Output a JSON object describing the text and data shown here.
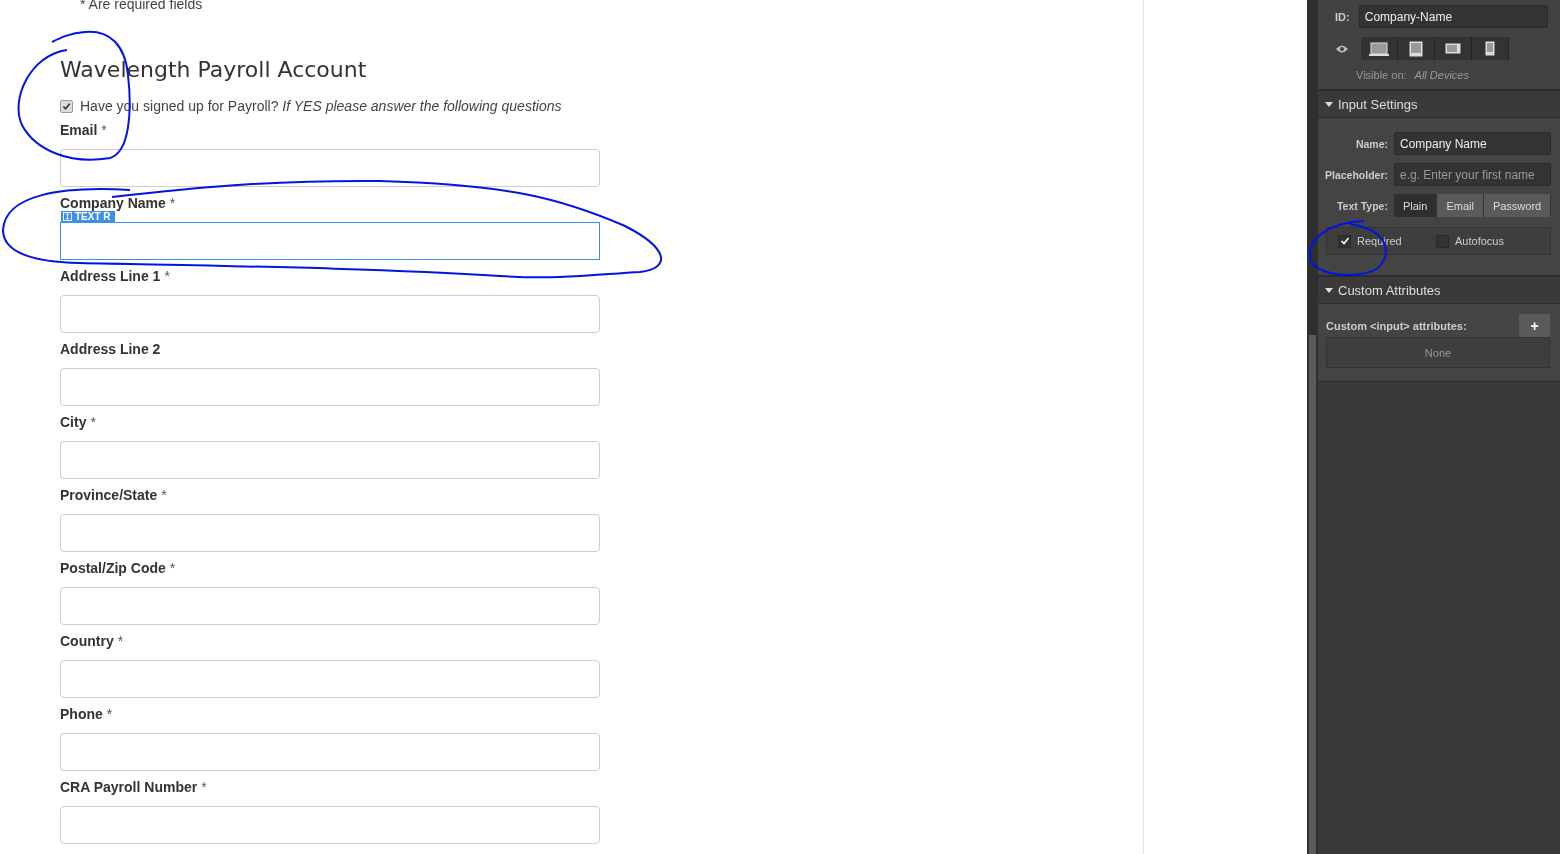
{
  "form": {
    "required_note": "* Are required fields",
    "title": "Wavelength Payroll Account",
    "signup": {
      "checked": true,
      "question": "Have you signed up for Payroll?",
      "hint": "If YES please answer the following questions"
    },
    "fields": [
      {
        "label": "Email",
        "mark": "*",
        "selected": false
      },
      {
        "label": "Company Name",
        "mark": "*",
        "selected": true,
        "tag": "TEXT R"
      },
      {
        "label": "Address Line 1",
        "mark": "*",
        "selected": false
      },
      {
        "label": "Address Line 2",
        "selected": false
      },
      {
        "label": "City",
        "mark": "*",
        "selected": false
      },
      {
        "label": "Province/State",
        "mark": "*",
        "selected": false
      },
      {
        "label": "Postal/Zip Code",
        "mark": "*",
        "selected": false
      },
      {
        "label": "Country",
        "mark": "*",
        "selected": false
      },
      {
        "label": "Phone",
        "mark": "*",
        "selected": false
      },
      {
        "label": "CRA Payroll Number",
        "mark": "*",
        "selected": false
      }
    ]
  },
  "panel": {
    "id_label": "ID:",
    "id_value": "Company-Name",
    "devices": [
      {
        "kind": "desktop"
      },
      {
        "kind": "tablet"
      },
      {
        "kind": "landscape"
      },
      {
        "kind": "phone"
      }
    ],
    "visible_label": "Visible on:",
    "visible_value": "All Devices",
    "input_settings": {
      "title": "Input Settings",
      "name_label": "Name:",
      "name_value": "Company Name",
      "placeholder_label": "Placeholder:",
      "placeholder": "e.g. Enter your first name",
      "type_label": "Text Type:",
      "types": [
        {
          "label": "Plain",
          "selected": true
        },
        {
          "label": "Email",
          "selected": false
        },
        {
          "label": "Password",
          "selected": false
        }
      ],
      "options": [
        {
          "label": "Required",
          "checked": true
        },
        {
          "label": "Autofocus",
          "checked": false
        }
      ]
    },
    "custom": {
      "title": "Custom Attributes",
      "label": "Custom <input> attributes:",
      "add": "+",
      "empty": "None"
    }
  }
}
